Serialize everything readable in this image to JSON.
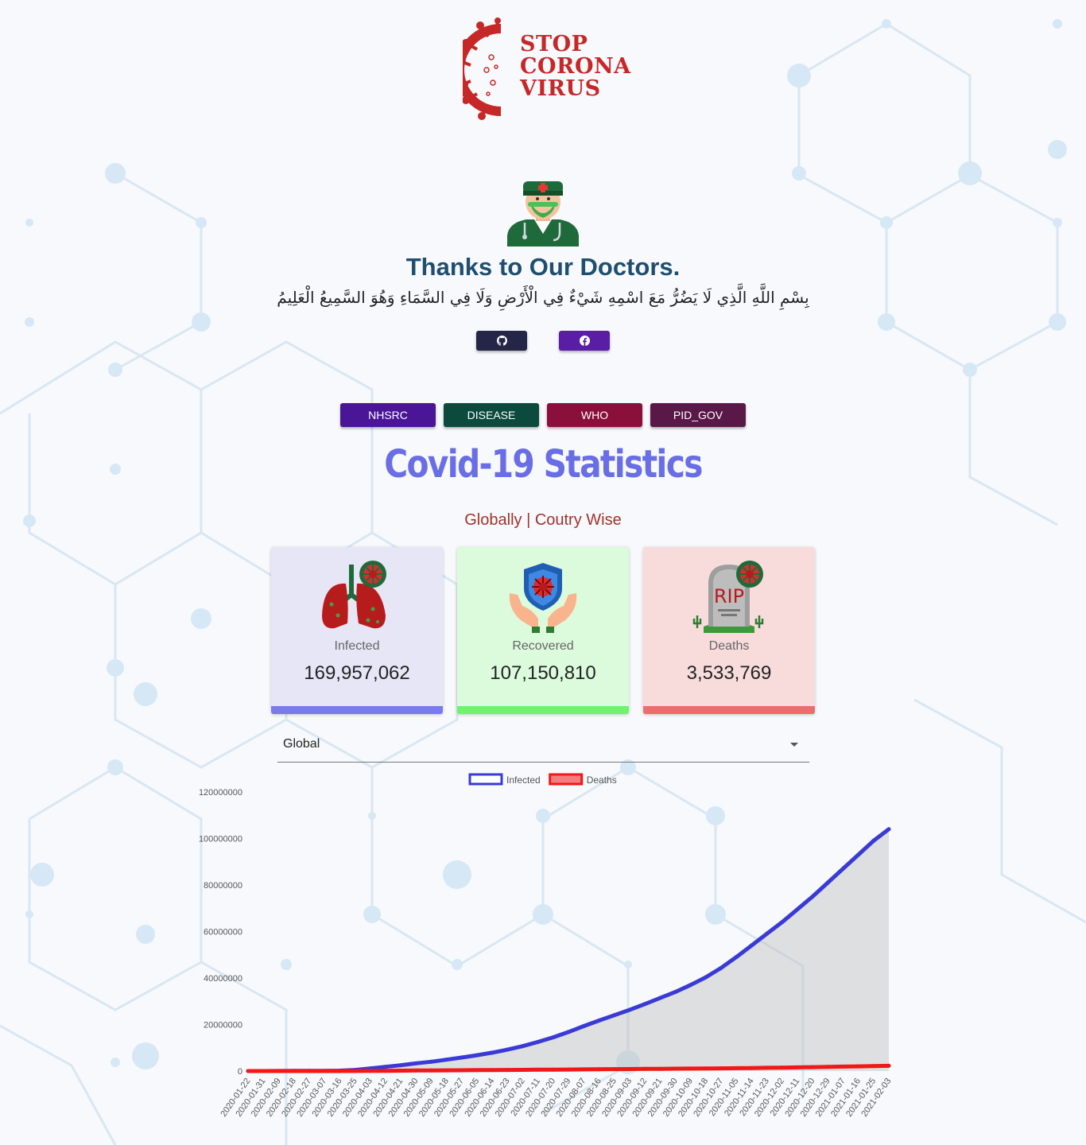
{
  "logo": {
    "line1": "STOP",
    "line2": "CORONA",
    "line3": "VIRUS"
  },
  "hero": {
    "title": "Thanks to Our Doctors.",
    "dua": "بِسْمِ اللَّهِ الَّذِي لَا يَضُرُّ مَعَ اسْمِهِ شَيْءٌ فِي الْأَرْضِ وَلَا فِي السَّمَاءِ وَهُوَ السَّمِيعُ الْعَلِيمُ"
  },
  "social": {
    "github_icon": "github-icon",
    "facebook_icon": "facebook-icon"
  },
  "links": [
    {
      "label": "NHSRC",
      "color": "#4a1596"
    },
    {
      "label": "DISEASE",
      "color": "#0b4a3c"
    },
    {
      "label": "WHO",
      "color": "#8a0f3a"
    },
    {
      "label": "PID_GOV",
      "color": "#5a1848"
    }
  ],
  "stats": {
    "title": "Covid-19 Statistics",
    "subtitle": "Globally | Coutry Wise",
    "cards": [
      {
        "label": "Infected",
        "value": "169,957,062",
        "icon": "lungs-virus-icon",
        "bg": "#e6e6f6",
        "bar": "#7b79ee"
      },
      {
        "label": "Recovered",
        "value": "107,150,810",
        "icon": "hands-shield-icon",
        "bg": "#dcfbdc",
        "bar": "#6ef36e"
      },
      {
        "label": "Deaths",
        "value": "3,533,769",
        "icon": "tombstone-rip-icon",
        "bg": "#f8dcdc",
        "bar": "#f06b6b"
      }
    ]
  },
  "country_select": {
    "value": "Global"
  },
  "chart_data": {
    "type": "line",
    "title": "",
    "xlabel": "",
    "ylabel": "",
    "ylim": [
      0,
      120000000
    ],
    "yticks": [
      0,
      20000000,
      40000000,
      60000000,
      80000000,
      100000000,
      120000000
    ],
    "x": [
      "2020-01-22",
      "2020-01-31",
      "2020-02-09",
      "2020-02-18",
      "2020-02-27",
      "2020-03-07",
      "2020-03-16",
      "2020-03-25",
      "2020-04-03",
      "2020-04-12",
      "2020-04-21",
      "2020-04-30",
      "2020-05-09",
      "2020-05-18",
      "2020-05-27",
      "2020-06-05",
      "2020-06-14",
      "2020-06-23",
      "2020-07-02",
      "2020-07-11",
      "2020-07-20",
      "2020-07-29",
      "2020-08-07",
      "2020-08-16",
      "2020-08-25",
      "2020-09-03",
      "2020-09-12",
      "2020-09-21",
      "2020-09-30",
      "2020-10-09",
      "2020-10-18",
      "2020-10-27",
      "2020-11-05",
      "2020-11-14",
      "2020-11-23",
      "2020-12-02",
      "2020-12-11",
      "2020-12-20",
      "2020-12-29",
      "2021-01-07",
      "2021-01-16",
      "2021-01-25",
      "2021-02-03"
    ],
    "series": [
      {
        "name": "Infected",
        "color": "#3a3ad6",
        "values": [
          600,
          10000,
          40000,
          75000,
          83000,
          105000,
          180000,
          470000,
          1100000,
          1800000,
          2500000,
          3300000,
          4000000,
          4900000,
          5800000,
          6800000,
          7900000,
          9200000,
          10700000,
          12500000,
          14500000,
          16800000,
          19300000,
          21700000,
          24000000,
          26300000,
          28800000,
          31400000,
          34000000,
          37000000,
          40300000,
          44300000,
          49000000,
          54000000,
          59000000,
          64000000,
          69500000,
          75000000,
          81000000,
          87000000,
          93000000,
          99000000,
          104000000
        ]
      },
      {
        "name": "Deaths",
        "color": "#f01818",
        "values": [
          17,
          213,
          813,
          1870,
          2860,
          3500,
          7000,
          22000,
          60000,
          115000,
          175000,
          230000,
          275000,
          315000,
          355000,
          395000,
          430000,
          480000,
          520000,
          565000,
          610000,
          660000,
          715000,
          770000,
          815000,
          865000,
          910000,
          960000,
          1010000,
          1060000,
          1110000,
          1160000,
          1230000,
          1300000,
          1390000,
          1480000,
          1580000,
          1690000,
          1800000,
          1910000,
          2020000,
          2140000,
          2260000
        ]
      }
    ],
    "legend": "top",
    "grid": false
  }
}
